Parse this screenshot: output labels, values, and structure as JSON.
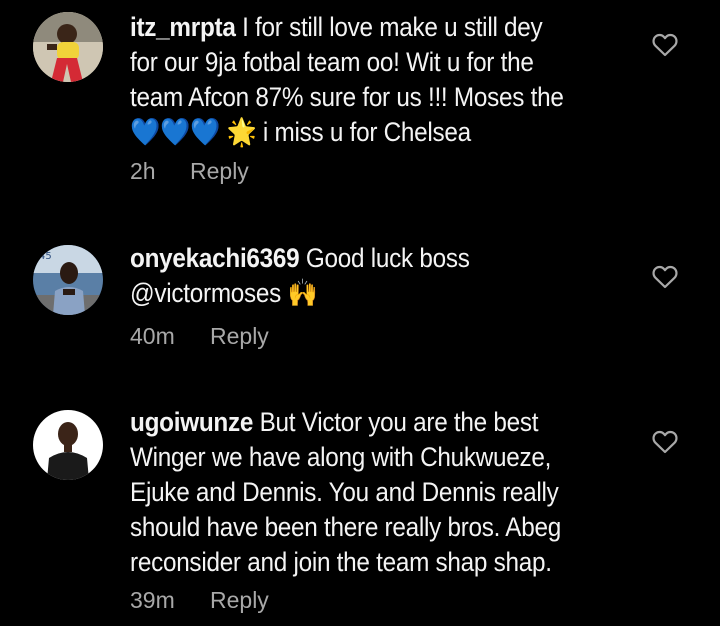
{
  "comments": [
    {
      "username": "itz_mrpta",
      "text_line1": " I for still love make u still dey",
      "text_line2": "for our 9ja fotbal team oo! Wit u for the",
      "text_line3": "team Afcon 87% sure for us !!! Moses the",
      "hearts": "💙💙💙",
      "star": "🌟",
      "text_line4_tail": " i miss u for Chelsea",
      "time": "2h",
      "reply_label": "Reply"
    },
    {
      "username": "onyekachi6369",
      "text_line1": " Good luck boss",
      "text_line2": "@victormoses",
      "hands": "🙌",
      "time": "40m",
      "reply_label": "Reply"
    },
    {
      "username": "ugoiwunze",
      "text_line1": " But Victor you are the best",
      "text_line2": "Winger we have along with Chukwueze,",
      "text_line3": "Ejuke and Dennis. You and Dennis really",
      "text_line4": "should have been there really bros. Abeg",
      "text_line5": "reconsider and join the team shap shap.",
      "time": "39m",
      "reply_label": "Reply"
    }
  ],
  "colors": {
    "background": "#000000",
    "text": "#f4f4f4",
    "meta": "#a8a8a8"
  },
  "icons": {
    "like": "heart-outline-icon"
  }
}
